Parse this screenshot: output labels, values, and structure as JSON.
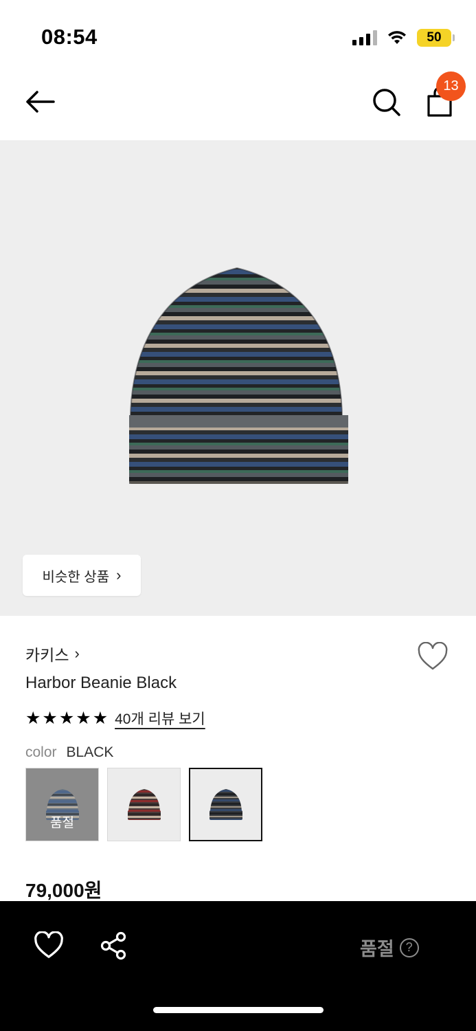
{
  "status_bar": {
    "time": "08:54",
    "battery": "50"
  },
  "nav": {
    "cart_count": "13"
  },
  "hero": {
    "similar_label": "비슷한 상품"
  },
  "product": {
    "brand": "카키스",
    "name": "Harbor Beanie Black",
    "rating_stars": 5,
    "review_link": "40개 리뷰 보기",
    "color_label": "color",
    "color_value": "BLACK",
    "swatches": [
      {
        "name": "blue",
        "soldout_label": "품절"
      },
      {
        "name": "brown"
      },
      {
        "name": "black"
      }
    ],
    "price": "79,000원"
  },
  "bottom_bar": {
    "soldout_label": "품절",
    "help_glyph": "?"
  },
  "icons": [
    "back-arrow-icon",
    "search-icon",
    "shopping-bag-icon",
    "heart-icon",
    "share-icon",
    "chevron-right-icon",
    "star-icon",
    "help-circle-icon"
  ],
  "colors": {
    "badge": "#f2541c",
    "battery": "#f5d327",
    "hero_bg": "#eeeeee",
    "bottom_bar": "#000000"
  }
}
